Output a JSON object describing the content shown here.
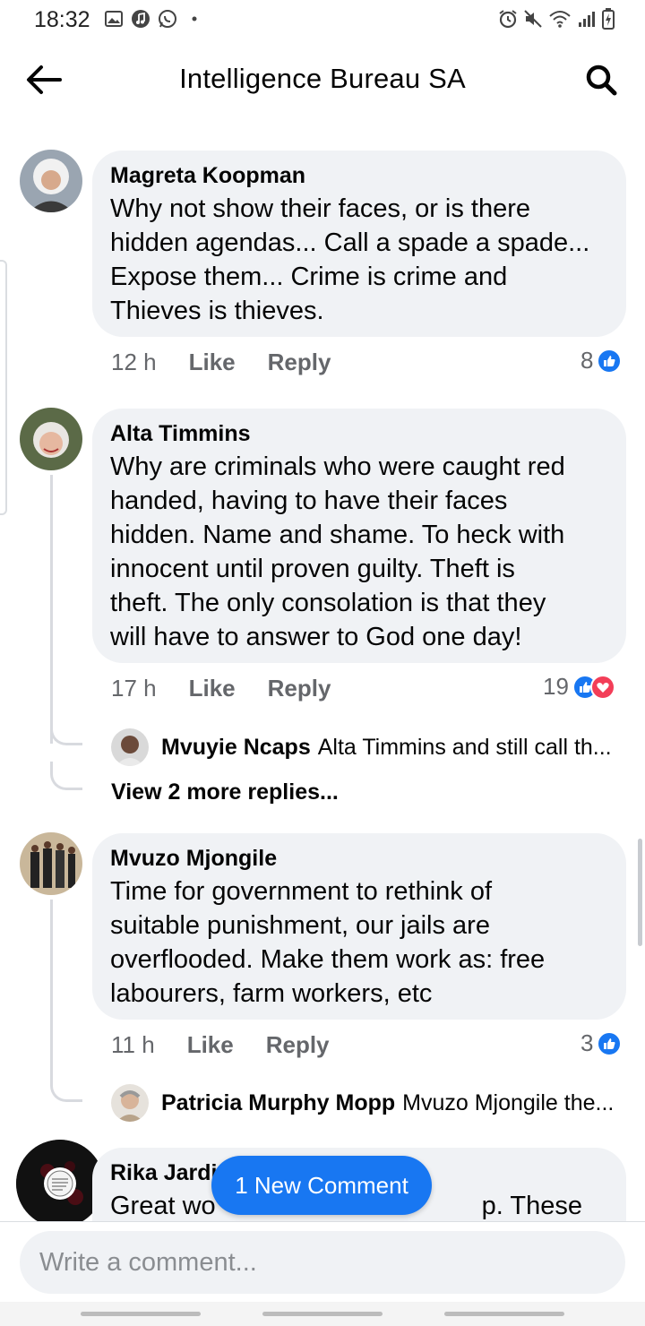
{
  "status_bar": {
    "time": "18:32",
    "left_icons": [
      "image-icon",
      "music-icon",
      "whatsapp-icon",
      "dot-icon"
    ],
    "right_icons": [
      "alarm-icon",
      "mute-icon",
      "wifi-icon",
      "signal-icon",
      "battery-icon"
    ]
  },
  "header": {
    "title": "Intelligence Bureau SA"
  },
  "comments": [
    {
      "name": "Magreta Koopman",
      "lines": [
        "Why not show their faces, or is there",
        "hidden agendas... Call a spade a spade...",
        "Expose them... Crime is crime and",
        "Thieves is thieves."
      ],
      "time": "12 h",
      "like": "Like",
      "reply": "Reply",
      "reactions": "8"
    },
    {
      "name": "Alta Timmins",
      "lines": [
        "Why are criminals who were caught red",
        "handed, having to have their faces",
        "hidden.  Name and shame.  To heck with",
        "innocent until proven guilty.  Theft is",
        "theft.  The only consolation is that they",
        "will have to answer to God one day!"
      ],
      "time": "17 h",
      "like": "Like",
      "reply": "Reply",
      "reactions": "19",
      "reply_preview": {
        "name": "Mvuyie Ncaps",
        "text": "Alta Timmins and still call th..."
      },
      "view_more": "View 2 more replies..."
    },
    {
      "name": "Mvuzo Mjongile",
      "lines": [
        "Time for government to rethink of",
        "suitable punishment, our jails are",
        "overflooded. Make them work as: free",
        "labourers, farm workers, etc"
      ],
      "time": "11 h",
      "like": "Like",
      "reply": "Reply",
      "reactions": "3",
      "reply_preview": {
        "name": "Patricia Murphy Mopp",
        "text": "Mvuzo Mjongile the..."
      }
    },
    {
      "name": "Rika Jardi",
      "lines": [
        "Great wo",
        "p. These"
      ]
    }
  ],
  "new_comment_button": "1 New Comment",
  "composer": {
    "placeholder": "Write a comment..."
  },
  "colors": {
    "brand_blue": "#1877f2",
    "love_red": "#f33e58",
    "bubble_bg": "#f0f2f5",
    "meta_gray": "#65676b"
  }
}
